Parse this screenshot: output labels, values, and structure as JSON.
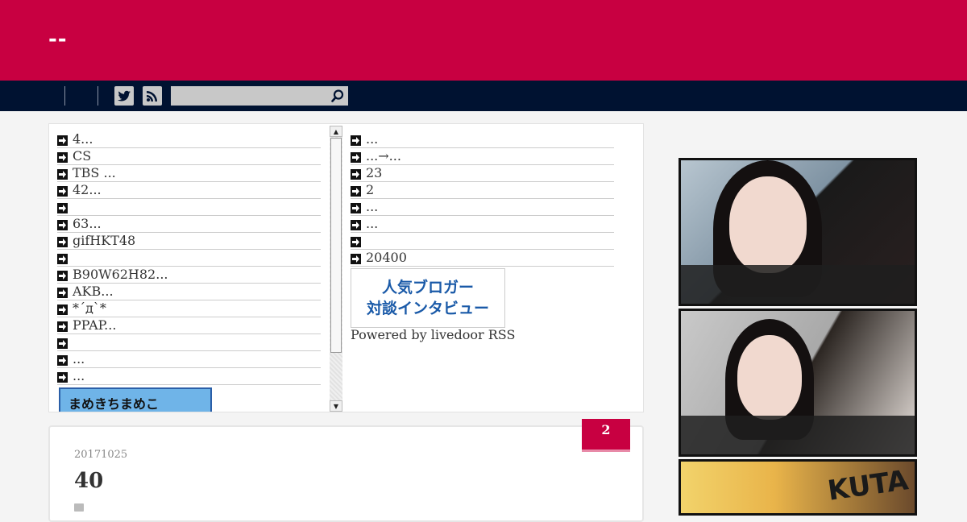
{
  "header": {
    "site_title": "--"
  },
  "nav": {
    "search_placeholder": "",
    "icons": [
      "twitter-icon",
      "rss-icon",
      "search-icon"
    ]
  },
  "widget": {
    "left_items": [
      "4...",
      "CS",
      "TBS ...",
      "42...",
      "",
      "63...",
      "gifHKT48",
      "",
      "B90W62H82...",
      "AKB...",
      "*´д`*",
      "PPAP...",
      "",
      "...",
      "..."
    ],
    "banner_text": "まめきちまめこ",
    "right_items": [
      "...",
      "...→...",
      "23",
      "2",
      "...",
      "...",
      "",
      "20400"
    ],
    "rss_banner_line1": "人気ブロガー",
    "rss_banner_line2": "対談インタビュー",
    "powered_by": "Powered by livedoor RSS"
  },
  "article": {
    "comment_count": "2",
    "date": "20171025",
    "title": "40"
  },
  "sidebar": {
    "image3_text": "KUTA"
  },
  "colors": {
    "header_bg": "#c80041",
    "nav_bg": "#001231",
    "accent": "#c80041"
  }
}
